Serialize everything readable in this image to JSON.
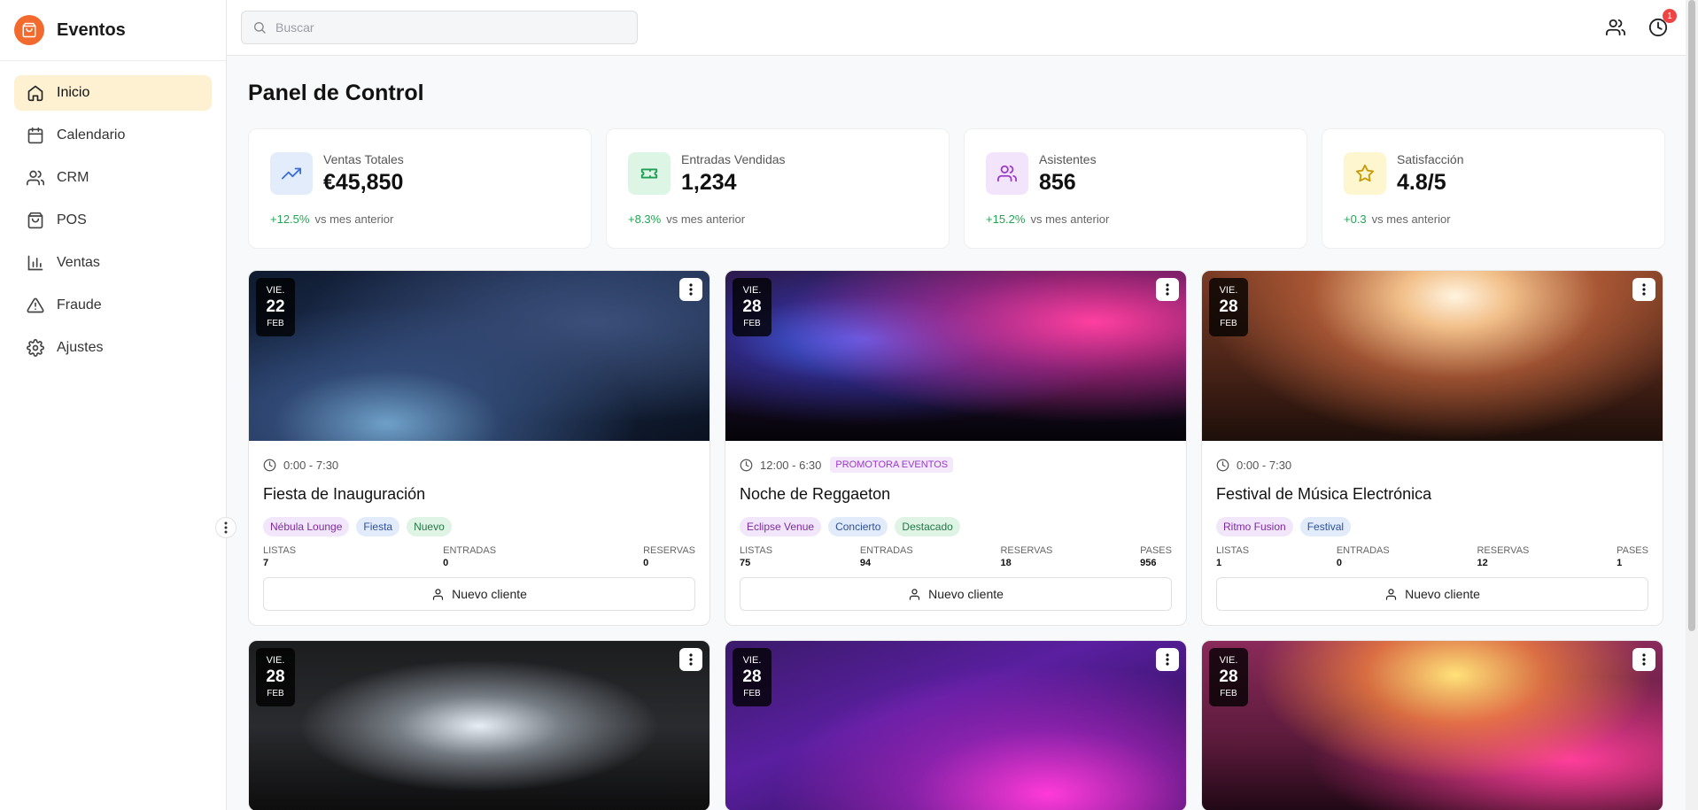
{
  "brand": {
    "name": "Eventos",
    "color": "#f26a2e"
  },
  "sidebar": {
    "items": [
      {
        "label": "Inicio",
        "icon": "home-icon",
        "active": true
      },
      {
        "label": "Calendario",
        "icon": "calendar-icon",
        "active": false
      },
      {
        "label": "CRM",
        "icon": "users-icon",
        "active": false
      },
      {
        "label": "POS",
        "icon": "shopping-bag-icon",
        "active": false
      },
      {
        "label": "Ventas",
        "icon": "bar-chart-icon",
        "active": false
      },
      {
        "label": "Fraude",
        "icon": "alert-triangle-icon",
        "active": false
      },
      {
        "label": "Ajustes",
        "icon": "gear-icon",
        "active": false
      }
    ]
  },
  "topbar": {
    "search_placeholder": "Buscar",
    "notification_count": "1"
  },
  "main": {
    "title": "Panel de Control",
    "stats": [
      {
        "label": "Ventas Totales",
        "value": "€45,850",
        "delta": "+12.5%",
        "vs": "vs mes anterior",
        "icon": "trending-up-icon",
        "color": "#3b6fd8",
        "bg": "#e3ecfb"
      },
      {
        "label": "Entradas Vendidas",
        "value": "1,234",
        "delta": "+8.3%",
        "vs": "vs mes anterior",
        "icon": "ticket-icon",
        "color": "#1f9d55",
        "bg": "#ddf5e4"
      },
      {
        "label": "Asistentes",
        "value": "856",
        "delta": "+15.2%",
        "vs": "vs mes anterior",
        "icon": "users-icon",
        "color": "#9b39c8",
        "bg": "#f2e5fb"
      },
      {
        "label": "Satisfacción",
        "value": "4.8/5",
        "delta": "+0.3",
        "vs": "vs mes anterior",
        "icon": "star-icon",
        "color": "#c99a06",
        "bg": "#fdf6cf"
      }
    ],
    "cards": [
      {
        "dow": "VIE.",
        "day": "22",
        "month": "FEB",
        "time": "0:00 - 7:30",
        "promoter": "",
        "title": "Fiesta de Inauguración",
        "tags": [
          {
            "text": "Nébula Lounge",
            "kind": "venue"
          },
          {
            "text": "Fiesta",
            "kind": "type"
          },
          {
            "text": "Nuevo",
            "kind": "flag"
          }
        ],
        "metrics": [
          {
            "label": "LISTAS",
            "value": "7"
          },
          {
            "label": "ENTRADAS",
            "value": "0"
          },
          {
            "label": "RESERVAS",
            "value": "0"
          }
        ],
        "button": "Nuevo cliente",
        "scene": "confetti"
      },
      {
        "dow": "VIE.",
        "day": "28",
        "month": "FEB",
        "time": "12:00 - 6:30",
        "promoter": "PROMOTORA EVENTOS",
        "title": "Noche de Reggaeton",
        "tags": [
          {
            "text": "Eclipse Venue",
            "kind": "venue"
          },
          {
            "text": "Concierto",
            "kind": "type"
          },
          {
            "text": "Destacado",
            "kind": "flag"
          }
        ],
        "metrics": [
          {
            "label": "LISTAS",
            "value": "75"
          },
          {
            "label": "ENTRADAS",
            "value": "94"
          },
          {
            "label": "RESERVAS",
            "value": "18"
          },
          {
            "label": "PASES",
            "value": "956"
          }
        ],
        "button": "Nuevo cliente",
        "scene": "concert"
      },
      {
        "dow": "VIE.",
        "day": "28",
        "month": "FEB",
        "time": "0:00 - 7:30",
        "promoter": "",
        "title": "Festival de Música Electrónica",
        "tags": [
          {
            "text": "Ritmo Fusion",
            "kind": "venue"
          },
          {
            "text": "Festival",
            "kind": "type"
          }
        ],
        "metrics": [
          {
            "label": "LISTAS",
            "value": "1"
          },
          {
            "label": "ENTRADAS",
            "value": "0"
          },
          {
            "label": "RESERVAS",
            "value": "12"
          },
          {
            "label": "PASES",
            "value": "1"
          }
        ],
        "button": "Nuevo cliente",
        "scene": "festival"
      },
      {
        "dow": "VIE.",
        "day": "28",
        "month": "FEB",
        "scene": "crowd"
      },
      {
        "dow": "VIE.",
        "day": "28",
        "month": "FEB",
        "scene": "dj"
      },
      {
        "dow": "VIE.",
        "day": "28",
        "month": "FEB",
        "scene": "phone"
      }
    ]
  }
}
